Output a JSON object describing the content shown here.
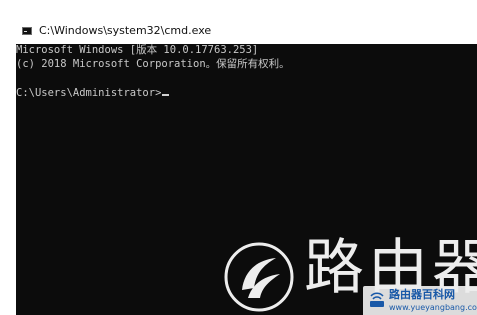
{
  "window": {
    "title": "C:\\Windows\\system32\\cmd.exe",
    "icon": "cmd-console-icon"
  },
  "console": {
    "lines": [
      "Microsoft Windows [版本 10.0.17763.253]",
      "(c) 2018 Microsoft Corporation。保留所有权利。"
    ],
    "prompt": "C:\\Users\\Administrator>",
    "colors": {
      "background": "#0c0c0c",
      "text": "#c8c8c8"
    }
  },
  "watermark": {
    "big_text": "路由器",
    "site_name": "路由器百科网",
    "site_url": "www.yueyangbang.com",
    "color": "#1a5fb4"
  }
}
